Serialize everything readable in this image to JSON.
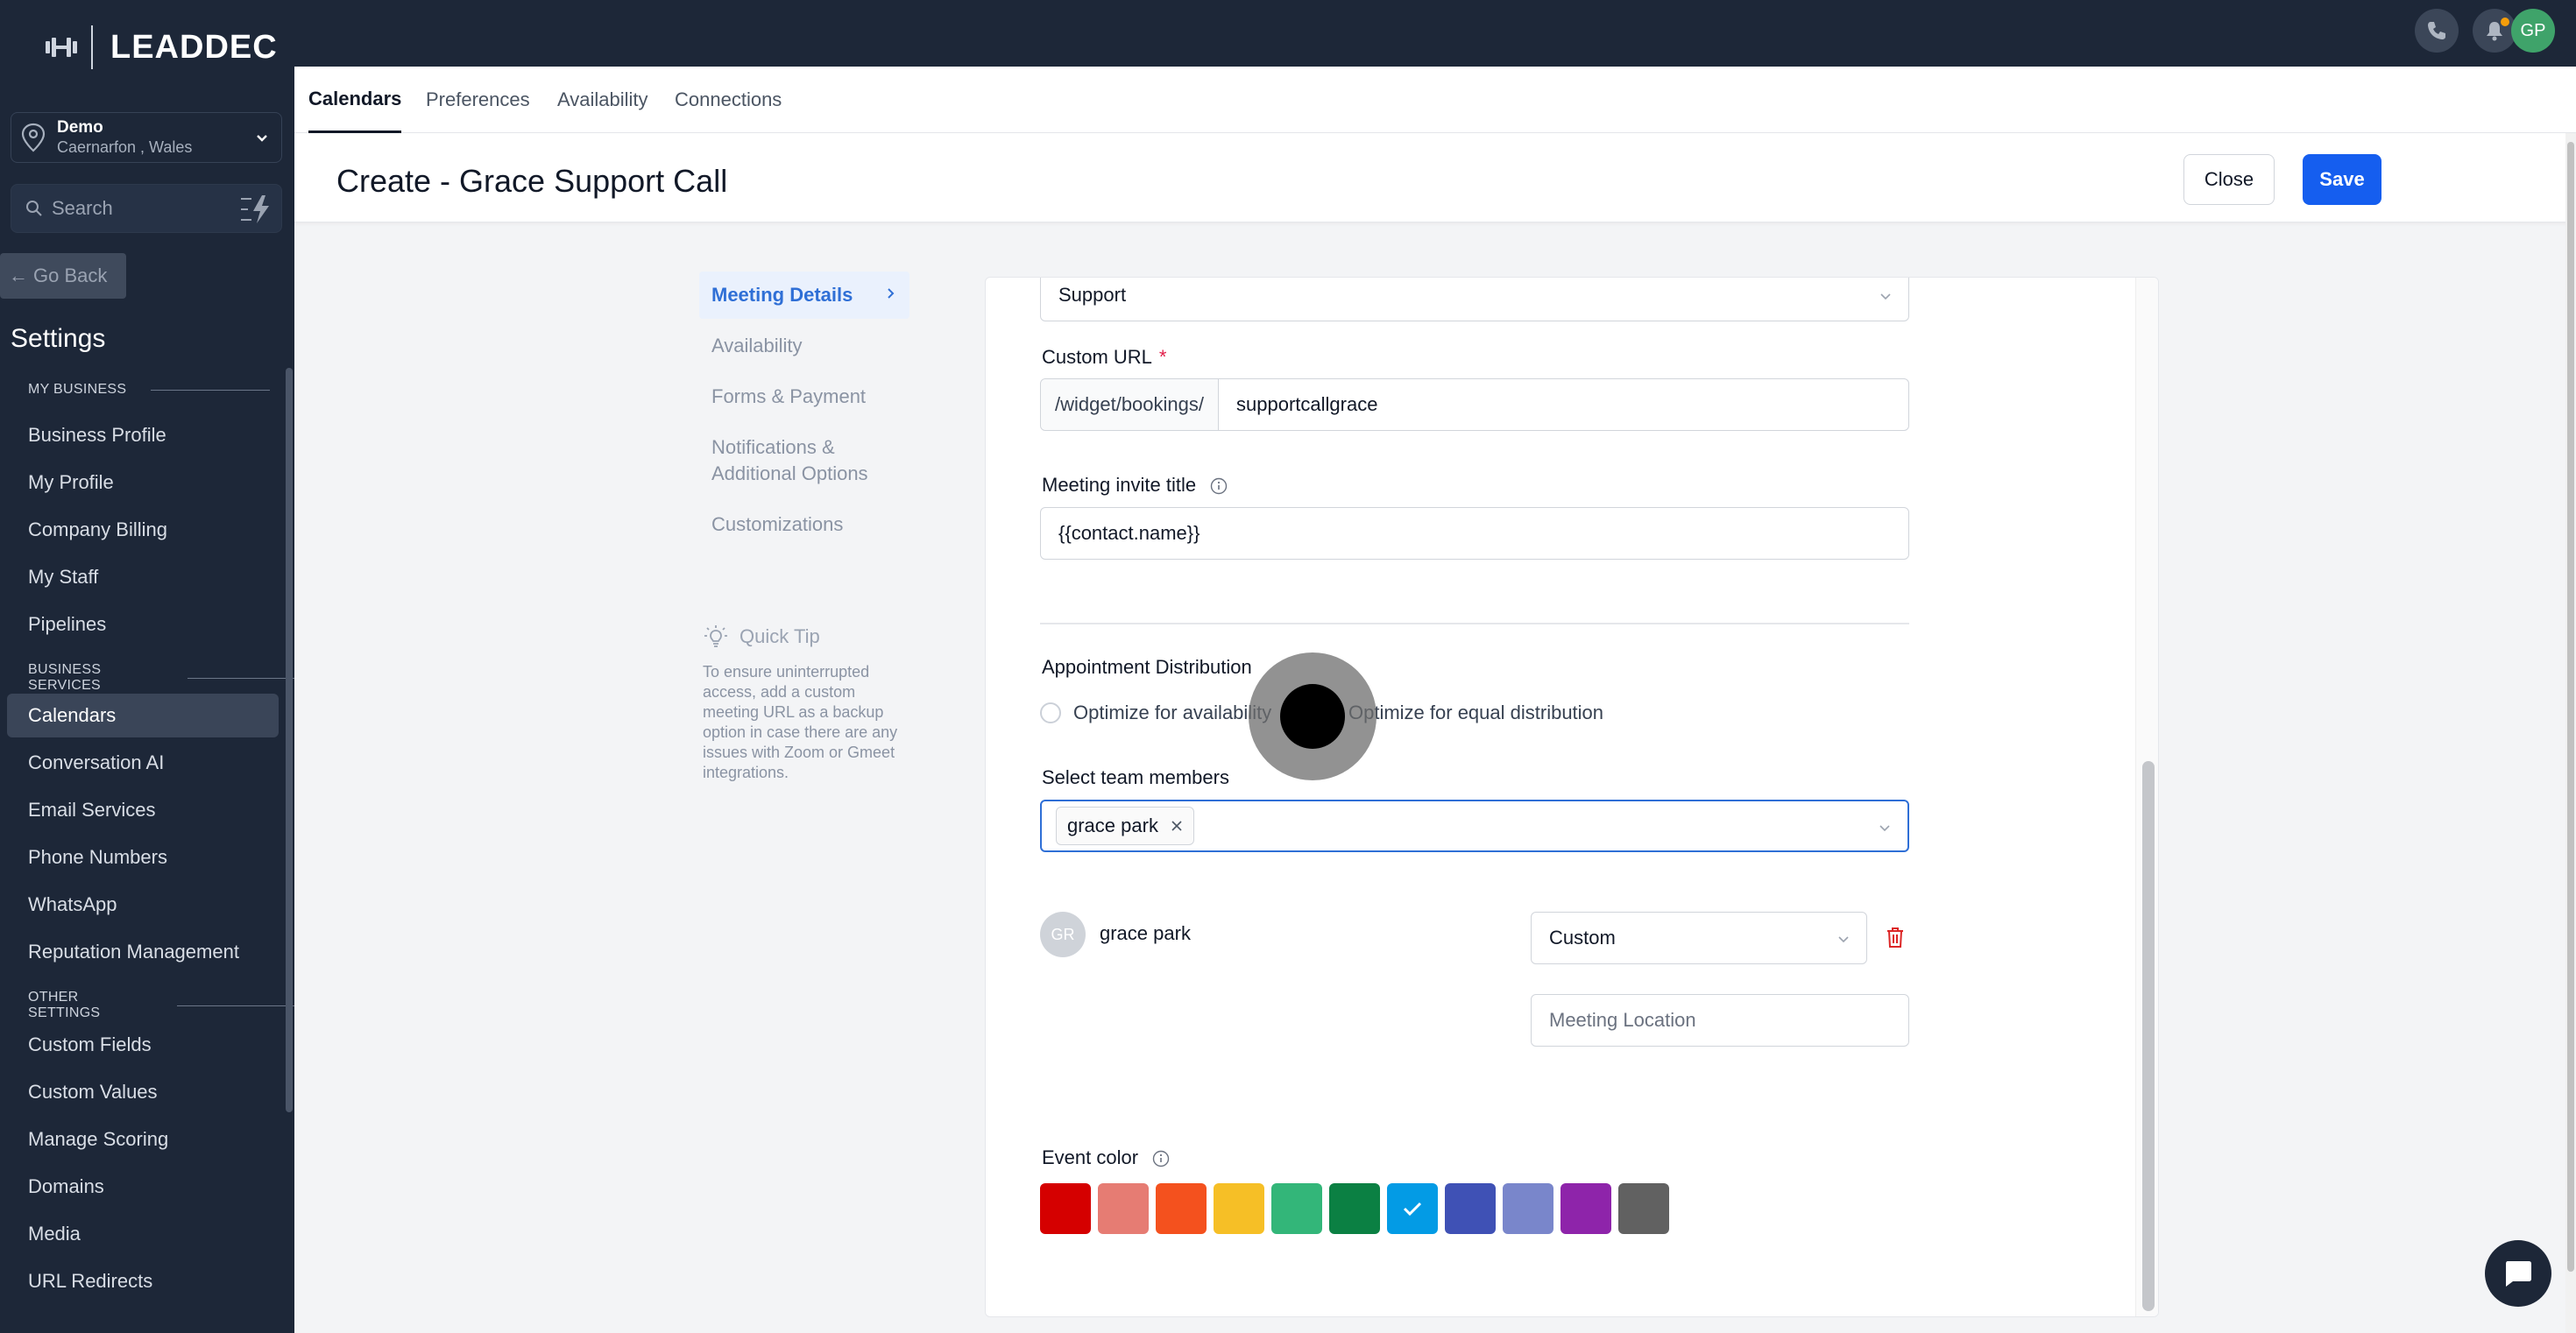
{
  "brand": {
    "name": "LEADDEC"
  },
  "location": {
    "name": "Demo",
    "address": "Caernarfon , Wales"
  },
  "search": {
    "placeholder": "Search"
  },
  "go_back": {
    "label": "Go Back"
  },
  "settings_title": "Settings",
  "sidebar": {
    "sections": [
      {
        "title": "MY BUSINESS",
        "items": [
          "Business Profile",
          "My Profile",
          "Company Billing",
          "My Staff",
          "Pipelines"
        ]
      },
      {
        "title": "BUSINESS SERVICES",
        "items": [
          "Calendars",
          "Conversation AI",
          "Email Services",
          "Phone Numbers",
          "WhatsApp",
          "Reputation Management"
        ]
      },
      {
        "title": "OTHER SETTINGS",
        "items": [
          "Custom Fields",
          "Custom Values",
          "Manage Scoring",
          "Domains",
          "Media",
          "URL Redirects"
        ]
      }
    ],
    "active_item": "Calendars"
  },
  "topbar": {
    "avatar_initials": "GP"
  },
  "tabs": [
    "Calendars",
    "Preferences",
    "Availability",
    "Connections"
  ],
  "header": {
    "title": "Create - Grace Support Call",
    "close_label": "Close",
    "save_label": "Save"
  },
  "steps": [
    "Meeting Details",
    "Availability",
    "Forms & Payment",
    "Notifications & Additional Options",
    "Customizations"
  ],
  "tip": {
    "title": "Quick Tip",
    "body": "To ensure uninterrupted access, add a custom meeting URL as a backup option in case there are any issues with Zoom or Gmeet integrations."
  },
  "form": {
    "group_value": "Support",
    "custom_url": {
      "label": "Custom URL",
      "required_mark": "*",
      "prefix": "/widget/bookings/",
      "value": "supportcallgrace"
    },
    "invite_title": {
      "label": "Meeting invite title",
      "value": "{{contact.name}}"
    },
    "distribution": {
      "label": "Appointment Distribution",
      "option_1": "Optimize for availability",
      "option_2": "Optimize for equal distribution"
    },
    "team": {
      "label": "Select team members",
      "chip": "grace park"
    },
    "member": {
      "initials": "GR",
      "name": "grace park",
      "location_type": "Custom",
      "location_placeholder": "Meeting Location"
    },
    "event_color": {
      "label": "Event color",
      "colors": [
        "#d50000",
        "#e67c73",
        "#f4511e",
        "#f6bf26",
        "#33b679",
        "#0b8043",
        "#039be5",
        "#3f51b5",
        "#7986cb",
        "#8e24aa",
        "#616161"
      ],
      "selected_index": 6
    }
  }
}
